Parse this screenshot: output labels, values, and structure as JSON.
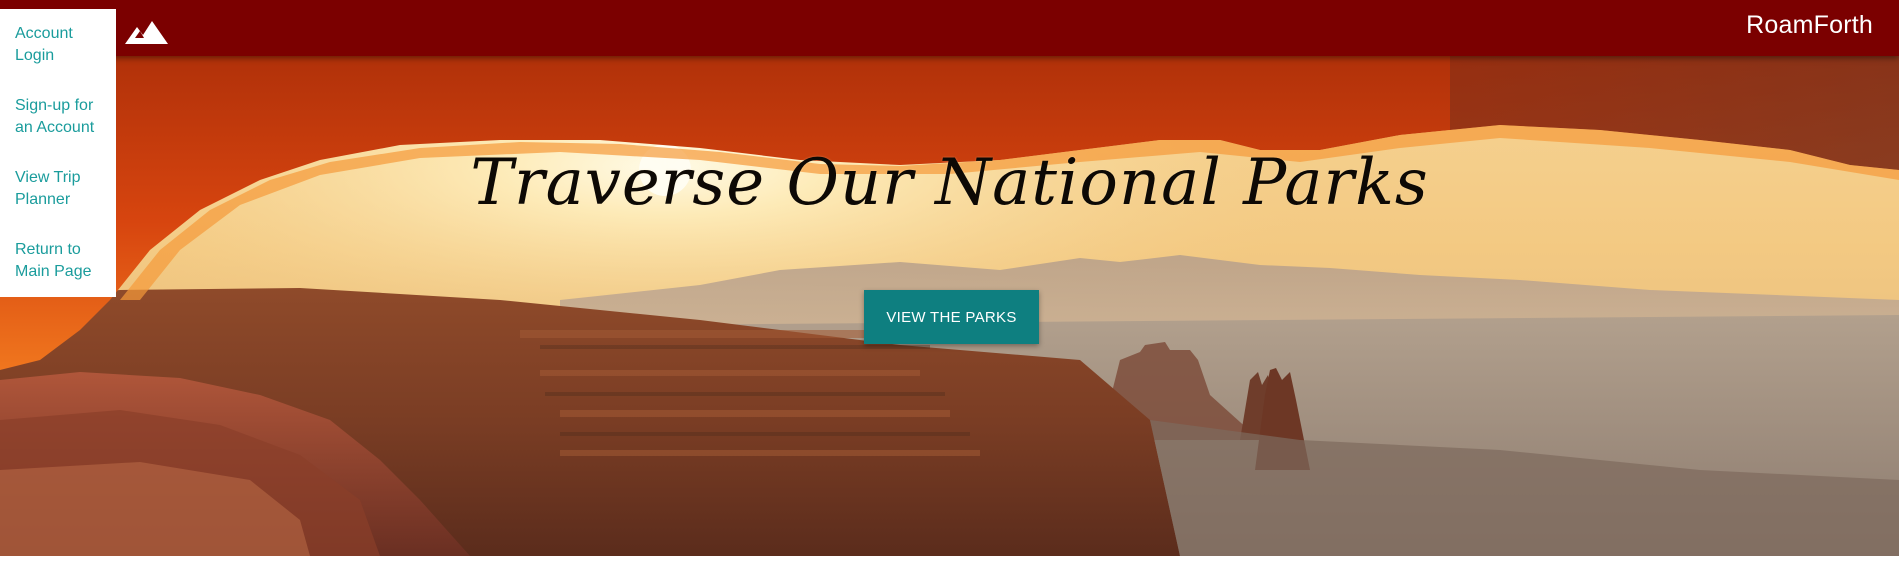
{
  "header": {
    "brand": "RoamForth",
    "logo_icon": "mountain-icon",
    "background_color": "#7b0000"
  },
  "sidebar": {
    "items": [
      {
        "label": "Account Login"
      },
      {
        "label": "Sign-up for an Account"
      },
      {
        "label": "View Trip Planner"
      },
      {
        "label": "Return to Main Page"
      }
    ],
    "link_color": "#1a9c9c"
  },
  "hero": {
    "title": "Traverse Our National Parks",
    "cta_label": "VIEW THE PARKS",
    "cta_color": "#0e7f80"
  }
}
